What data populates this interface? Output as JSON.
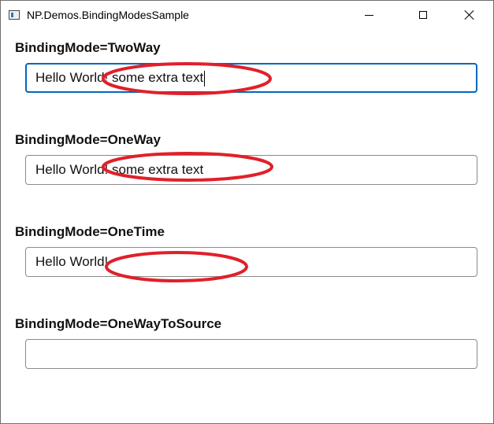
{
  "window": {
    "title": "NP.Demos.BindingModesSample",
    "app_icon": "app-window-icon",
    "controls": {
      "minimize_icon": "minimize-icon",
      "maximize_icon": "maximize-icon",
      "close_icon": "close-icon"
    }
  },
  "sections": [
    {
      "label": "BindingMode=TwoWay",
      "value": "Hello World! some extra text",
      "focused": true
    },
    {
      "label": "BindingMode=OneWay",
      "value": "Hello World! some extra text",
      "focused": false
    },
    {
      "label": "BindingMode=OneTime",
      "value": "Hello World!",
      "focused": false
    },
    {
      "label": "BindingMode=OneWayToSource",
      "value": "",
      "focused": false
    }
  ],
  "annotation": {
    "color": "#e0202a",
    "shape": "ellipse-highlight"
  },
  "colors": {
    "focus_border": "#0067c0",
    "field_border": "#8a8a8a"
  }
}
